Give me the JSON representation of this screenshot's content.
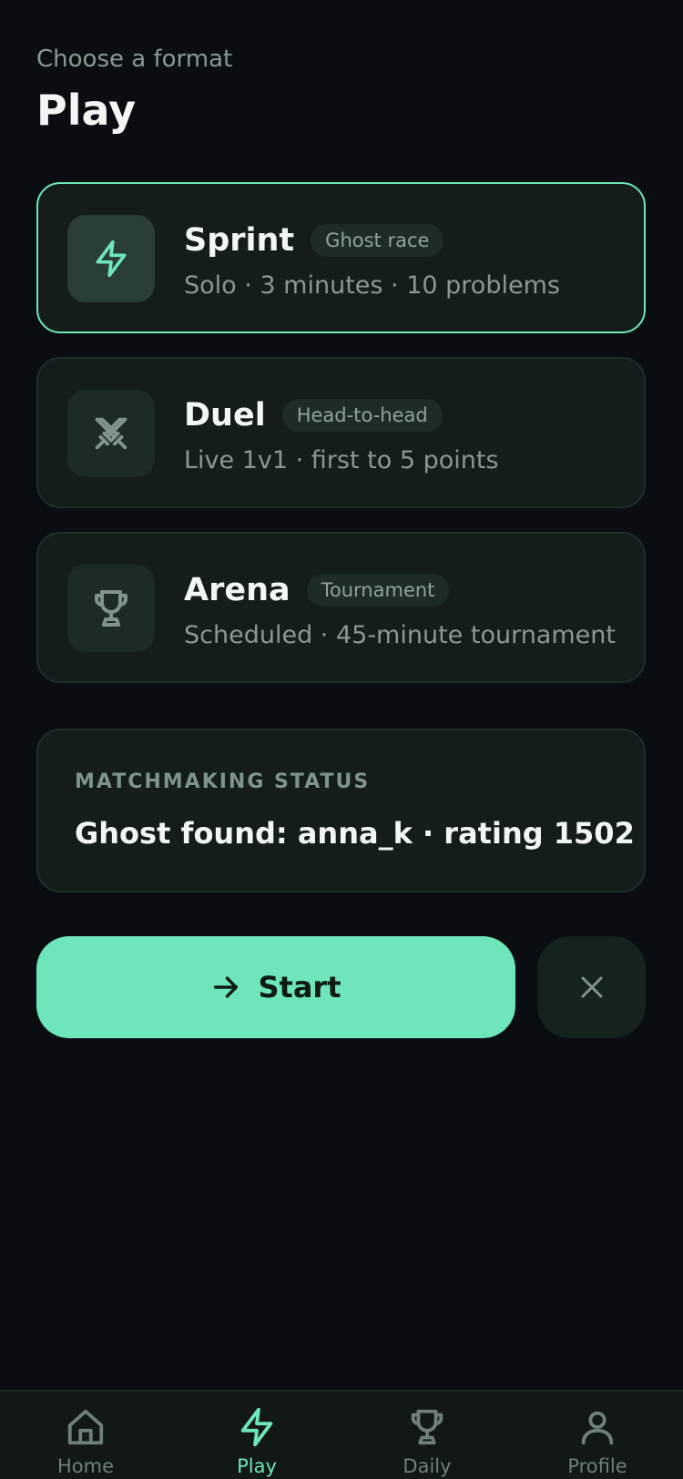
{
  "header": {
    "subtitle": "Choose a format",
    "title": "Play"
  },
  "formats": [
    {
      "name": "Sprint",
      "badge": "Ghost race",
      "description": "Solo · 3 minutes · 10 problems",
      "icon": "lightning-icon",
      "selected": true
    },
    {
      "name": "Duel",
      "badge": "Head-to-head",
      "description": "Live 1v1 · first to 5 points",
      "icon": "crossed-swords-icon",
      "selected": false
    },
    {
      "name": "Arena",
      "badge": "Tournament",
      "description": "Scheduled · 45-minute tournament",
      "icon": "trophy-icon",
      "selected": false
    }
  ],
  "status": {
    "label": "MATCHMAKING STATUS",
    "value": "Ghost found: anna_k · rating 1502"
  },
  "actions": {
    "start_label": "Start",
    "start_icon": "arrow-right-icon",
    "cancel_icon": "close-icon"
  },
  "tabbar": {
    "active": "Play",
    "items": [
      {
        "label": "Home",
        "icon": "home-icon"
      },
      {
        "label": "Play",
        "icon": "lightning-icon"
      },
      {
        "label": "Daily",
        "icon": "trophy-icon"
      },
      {
        "label": "Profile",
        "icon": "person-icon"
      }
    ]
  },
  "colors": {
    "background": "#0a0e12",
    "accent": "#6fe6b9",
    "card": "#141d1b",
    "muted_text": "#8a9894"
  }
}
